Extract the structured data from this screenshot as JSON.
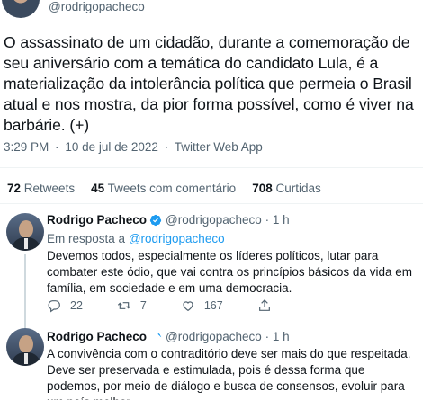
{
  "tweet": {
    "handle": "@rodrigopacheco",
    "text": "O assassinato de um cidadão, durante a comemoração de seu aniversário com a temática do candidato Lula, é a materialização da intolerância política que permeia o Brasil atual e nos mostra, da pior forma possível, como é viver na barbárie. (+)",
    "time": "3:29 PM",
    "date": "10 de jul de 2022",
    "source": "Twitter Web App",
    "separator": "·"
  },
  "stats": {
    "retweets_count": "72",
    "retweets_label": "Retweets",
    "quotes_count": "45",
    "quotes_label": "Tweets com comentário",
    "likes_count": "708",
    "likes_label": "Curtidas"
  },
  "replies": [
    {
      "name": "Rodrigo Pacheco",
      "handle": "@rodrigopacheco",
      "time": "1 h",
      "in_reply_prefix": "Em resposta a",
      "in_reply_mention": "@rodrigopacheco",
      "text": "Devemos todos, especialmente os líderes políticos, lutar para combater este ódio, que vai contra os princípios básicos da vida em família, em sociedade e em uma democracia.",
      "reply_count": "22",
      "retweet_count": "7",
      "like_count": "167"
    },
    {
      "name": "Rodrigo Pacheco",
      "handle": "@rodrigopacheco",
      "time": "1 h",
      "text": "A convivência com o contraditório deve ser mais do que respeitada. Deve ser preservada e estimulada, pois é dessa forma que podemos, por meio de diálogo e busca de consensos, evoluir para um país melhor."
    }
  ],
  "colors": {
    "accent": "#1d9bf0",
    "secondary_text": "#536471",
    "divider": "#eff3f4"
  },
  "icons": [
    "verified-badge-icon",
    "reply-icon",
    "retweet-icon",
    "like-icon",
    "share-icon"
  ]
}
